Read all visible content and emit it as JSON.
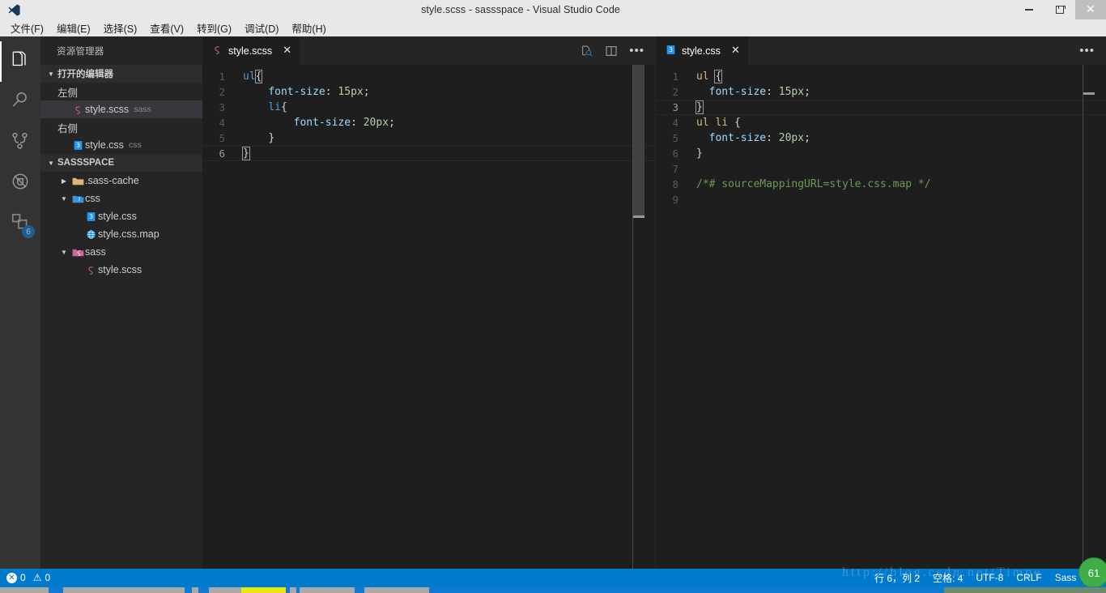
{
  "titlebar": {
    "title": "style.scss - sassspace - Visual Studio Code",
    "logo_icon": "vscode-logo-icon",
    "minimize_label": "",
    "maximize_label": "",
    "close_label": "✕"
  },
  "menubar": {
    "items": [
      {
        "label": "文件(F)",
        "name": "menu-file"
      },
      {
        "label": "编辑(E)",
        "name": "menu-edit"
      },
      {
        "label": "选择(S)",
        "name": "menu-selection"
      },
      {
        "label": "查看(V)",
        "name": "menu-view"
      },
      {
        "label": "转到(G)",
        "name": "menu-goto"
      },
      {
        "label": "调试(D)",
        "name": "menu-debug"
      },
      {
        "label": "帮助(H)",
        "name": "menu-help"
      }
    ]
  },
  "activitybar": {
    "items": [
      {
        "icon": "files-explorer-icon",
        "name": "activity-explorer",
        "active": true
      },
      {
        "icon": "search-icon",
        "name": "activity-search",
        "active": false
      },
      {
        "icon": "source-control-icon",
        "name": "activity-source-control",
        "active": false
      },
      {
        "icon": "debug-icon",
        "name": "activity-debug",
        "active": false
      },
      {
        "icon": "extensions-icon",
        "name": "activity-extensions",
        "active": false,
        "badge": "6"
      }
    ]
  },
  "sidebar": {
    "title": "资源管理器",
    "open_editors": {
      "label": "打开的编辑器",
      "groups": [
        {
          "label": "左侧",
          "files": [
            {
              "name": "style.scss",
              "desc": "sass",
              "icon": "sass-file-icon",
              "selected": true
            }
          ]
        },
        {
          "label": "右侧",
          "files": [
            {
              "name": "style.css",
              "desc": "css",
              "icon": "css-file-icon",
              "selected": false
            }
          ]
        }
      ]
    },
    "workspace": {
      "label": "SASSSPACE",
      "tree": [
        {
          "label": ".sass-cache",
          "type": "folder",
          "icon": "folder-icon",
          "expanded": false,
          "depth": 2
        },
        {
          "label": "css",
          "type": "folder",
          "icon": "folder-css-icon",
          "expanded": true,
          "depth": 2
        },
        {
          "label": "style.css",
          "type": "file",
          "icon": "css-file-icon",
          "depth": 3
        },
        {
          "label": "style.css.map",
          "type": "file",
          "icon": "map-file-icon",
          "depth": 3
        },
        {
          "label": "sass",
          "type": "folder",
          "icon": "folder-sass-icon",
          "expanded": true,
          "depth": 2
        },
        {
          "label": "style.scss",
          "type": "file",
          "icon": "sass-file-icon",
          "depth": 3
        }
      ]
    }
  },
  "editors": {
    "left": {
      "tab": {
        "label": "style.scss",
        "icon": "sass-file-icon",
        "close_label": "✕"
      },
      "actions": [
        {
          "icon": "preview-icon",
          "name": "open-preview-button"
        },
        {
          "icon": "split-editor-icon",
          "name": "split-editor-button"
        },
        {
          "icon": "more-actions-icon",
          "name": "more-actions-button",
          "label": "•••"
        }
      ],
      "lines": [
        {
          "num": "1",
          "tokens": [
            {
              "t": "ul",
              "c": "sel"
            },
            {
              "t": "{",
              "c": "punct cursor"
            }
          ]
        },
        {
          "num": "2",
          "tokens": [
            {
              "t": "    ",
              "c": "punct"
            },
            {
              "t": "font-size",
              "c": "prop"
            },
            {
              "t": ": ",
              "c": "punct"
            },
            {
              "t": "15px",
              "c": "num"
            },
            {
              "t": ";",
              "c": "punct"
            }
          ]
        },
        {
          "num": "3",
          "tokens": [
            {
              "t": "    ",
              "c": "punct"
            },
            {
              "t": "li",
              "c": "sel"
            },
            {
              "t": "{",
              "c": "punct"
            }
          ]
        },
        {
          "num": "4",
          "tokens": [
            {
              "t": "        ",
              "c": "punct"
            },
            {
              "t": "font-size",
              "c": "prop"
            },
            {
              "t": ": ",
              "c": "punct"
            },
            {
              "t": "20px",
              "c": "num"
            },
            {
              "t": ";",
              "c": "punct"
            }
          ]
        },
        {
          "num": "5",
          "tokens": [
            {
              "t": "    ",
              "c": "punct"
            },
            {
              "t": "}",
              "c": "punct"
            }
          ]
        },
        {
          "num": "6",
          "tokens": [
            {
              "t": "}",
              "c": "punct cursor"
            }
          ],
          "current": true
        }
      ]
    },
    "right": {
      "tab": {
        "label": "style.css",
        "icon": "css-file-icon",
        "close_label": "✕"
      },
      "actions": [
        {
          "icon": "more-actions-icon",
          "name": "more-actions-button-right",
          "label": "•••"
        }
      ],
      "lines": [
        {
          "num": "1",
          "tokens": [
            {
              "t": "ul ",
              "c": "selc"
            },
            {
              "t": "{",
              "c": "punct cursor"
            }
          ]
        },
        {
          "num": "2",
          "tokens": [
            {
              "t": "  ",
              "c": "punct"
            },
            {
              "t": "font-size",
              "c": "prop"
            },
            {
              "t": ": ",
              "c": "punct"
            },
            {
              "t": "15px",
              "c": "num"
            },
            {
              "t": ";",
              "c": "punct"
            }
          ]
        },
        {
          "num": "3",
          "tokens": [
            {
              "t": "}",
              "c": "punct cursor"
            }
          ],
          "current": true
        },
        {
          "num": "4",
          "tokens": [
            {
              "t": "ul li ",
              "c": "selc"
            },
            {
              "t": "{",
              "c": "punct"
            }
          ]
        },
        {
          "num": "5",
          "tokens": [
            {
              "t": "  ",
              "c": "punct"
            },
            {
              "t": "font-size",
              "c": "prop"
            },
            {
              "t": ": ",
              "c": "punct"
            },
            {
              "t": "20px",
              "c": "num"
            },
            {
              "t": ";",
              "c": "punct"
            }
          ]
        },
        {
          "num": "6",
          "tokens": [
            {
              "t": "}",
              "c": "punct"
            }
          ]
        },
        {
          "num": "7",
          "tokens": []
        },
        {
          "num": "8",
          "tokens": [
            {
              "t": "/*# sourceMappingURL=style.css.map */",
              "c": "comment"
            }
          ]
        },
        {
          "num": "9",
          "tokens": []
        }
      ]
    }
  },
  "statusbar": {
    "errors": "0",
    "warnings": "0",
    "position": "行 6，列 2",
    "indent": "空格: 4",
    "encoding": "UTF-8",
    "eol": "CRLF",
    "language": "Sass",
    "feedback_icon": "smiley-icon",
    "feedback_glyph": "☺"
  },
  "overlay": {
    "watermark": "http://blog.csdn.net/Timpe",
    "badge": "61"
  },
  "colors": {
    "accent": "#007acc",
    "editor_bg": "#1e1e1e",
    "sidebar_bg": "#252526",
    "activitybar_bg": "#333333",
    "titlebar_bg": "#e8e8e8",
    "selector_scss": "#569cd6",
    "selector_css": "#d7ba7d",
    "property": "#9cdcfe",
    "value": "#b5cea8",
    "comment": "#6a9955"
  }
}
